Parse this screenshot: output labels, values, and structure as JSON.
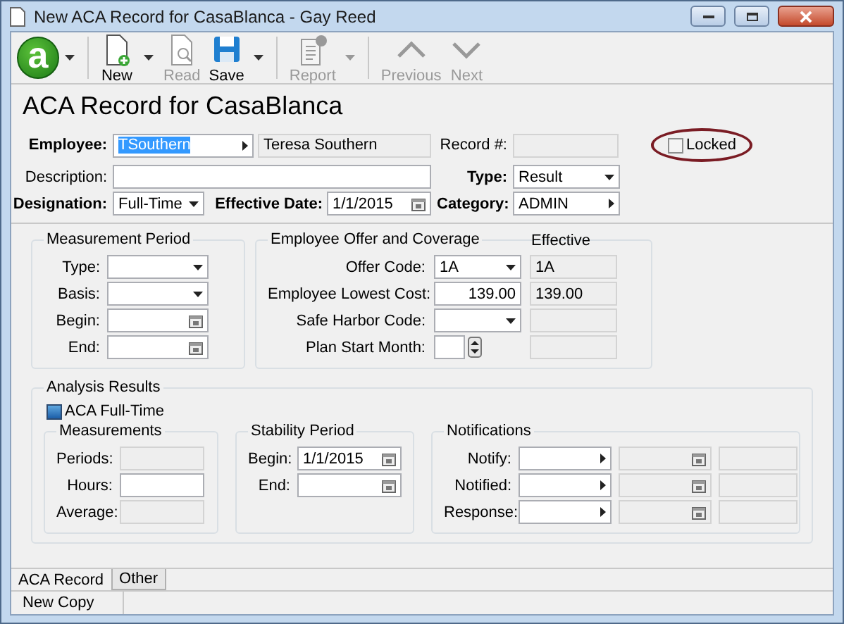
{
  "window": {
    "title": "New ACA Record for CasaBlanca - Gay Reed"
  },
  "toolbar": {
    "logo": {
      "letter": "a"
    },
    "groups": [
      [
        {
          "label": "New",
          "kind": "new",
          "disabled": false,
          "menu": true
        },
        {
          "label": "Read",
          "kind": "read",
          "disabled": true,
          "menu": false
        },
        {
          "label": "Save",
          "kind": "save",
          "disabled": false,
          "menu": true
        }
      ],
      [
        {
          "label": "Report",
          "kind": "report",
          "disabled": true,
          "menu": true
        }
      ],
      [
        {
          "label": "Previous",
          "kind": "previous",
          "disabled": true,
          "menu": false
        },
        {
          "label": "Next",
          "kind": "next",
          "disabled": true,
          "menu": false
        }
      ]
    ]
  },
  "heading": "ACA Record for CasaBlanca",
  "header": {
    "employee": {
      "label": "Employee:",
      "required": true,
      "kind": "lookup",
      "value": "TSouthern",
      "text_selected": true,
      "display_name": "Teresa Southern"
    },
    "record_number": {
      "label": "Record #:",
      "required": false,
      "kind": "readonly"
    },
    "locked": {
      "label": "Locked",
      "checked": false,
      "circled": true
    },
    "description": {
      "label": "Description:",
      "required": false,
      "kind": "text"
    },
    "type": {
      "label": "Type:",
      "required": true,
      "kind": "dropdown",
      "value": "Result"
    },
    "designation": {
      "label": "Designation:",
      "required": true,
      "kind": "dropdown",
      "value": "Full-Time"
    },
    "effective_date": {
      "label": "Effective Date:",
      "required": true,
      "kind": "date",
      "value": "1/1/2015"
    },
    "category": {
      "label": "Category:",
      "required": true,
      "kind": "lookup",
      "value": "ADMIN"
    }
  },
  "measurement_period": {
    "title": "Measurement Period",
    "fields": [
      {
        "label": "Type:",
        "kind": "dropdown"
      },
      {
        "label": "Basis:",
        "kind": "dropdown"
      },
      {
        "label": "Begin:",
        "kind": "date"
      },
      {
        "label": "End:",
        "kind": "date"
      }
    ]
  },
  "offer_coverage": {
    "title": "Employee Offer and Coverage",
    "effective_title": "Effective",
    "rows": [
      {
        "label": "Offer Code:",
        "kind": "dropdown",
        "value": "1A",
        "effective": "1A"
      },
      {
        "label": "Employee Lowest Cost:",
        "kind": "number",
        "value": "139.00",
        "effective": "139.00"
      },
      {
        "label": "Safe Harbor Code:",
        "kind": "dropdown"
      },
      {
        "label": "Plan Start Month:",
        "kind": "spinner"
      }
    ]
  },
  "analysis": {
    "title": "Analysis Results",
    "aca_full_time": {
      "label": "ACA Full-Time",
      "checked": true
    },
    "measurements": {
      "title": "Measurements",
      "fields": [
        {
          "label": "Periods:",
          "kind": "readonly"
        },
        {
          "label": "Hours:",
          "kind": "text"
        },
        {
          "label": "Average:",
          "kind": "readonly"
        }
      ]
    },
    "stability_period": {
      "title": "Stability Period",
      "fields": [
        {
          "label": "Begin:",
          "kind": "date",
          "value": "1/1/2015"
        },
        {
          "label": "End:",
          "kind": "date"
        }
      ]
    },
    "notifications": {
      "title": "Notifications",
      "rows": [
        {
          "label": "Notify:"
        },
        {
          "label": "Notified:"
        },
        {
          "label": "Response:"
        }
      ]
    }
  },
  "tabs": [
    {
      "label": "ACA Record",
      "selected": true
    },
    {
      "label": "Other",
      "selected": false
    }
  ],
  "status_bar": {
    "button": "New Copy"
  }
}
